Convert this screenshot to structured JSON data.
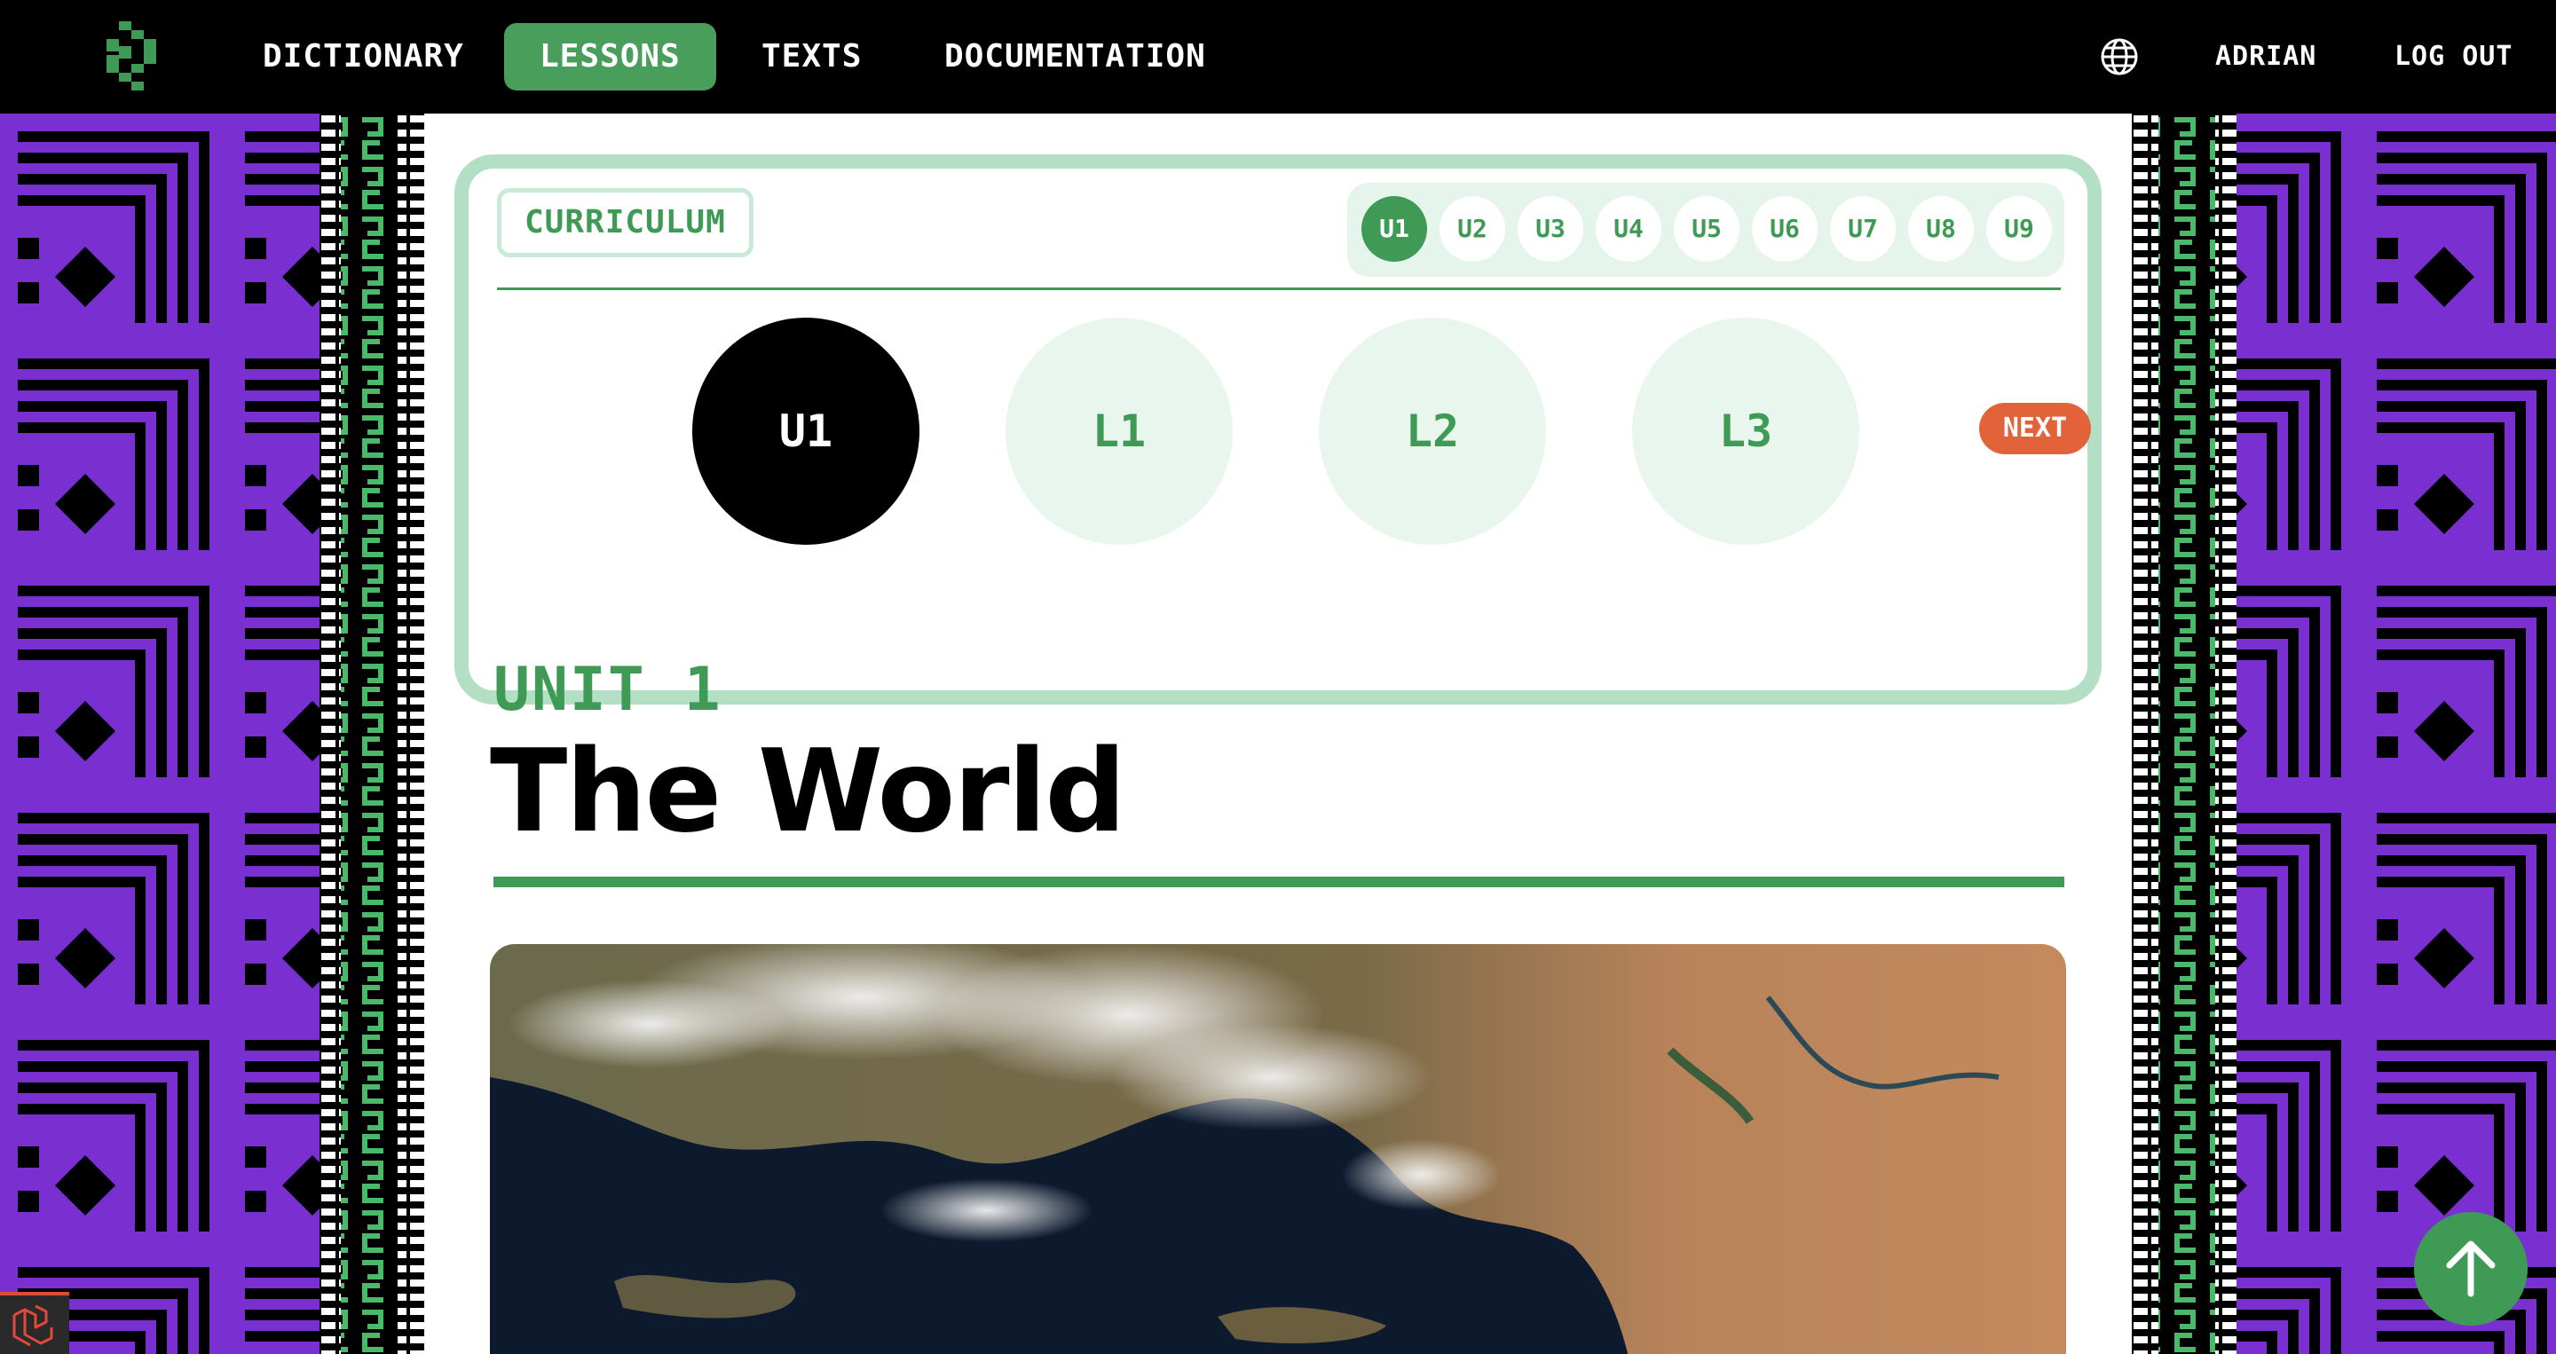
{
  "nav": {
    "links": [
      "DICTIONARY",
      "LESSONS",
      "TEXTS",
      "DOCUMENTATION"
    ],
    "active": "LESSONS",
    "user": "ADRIAN",
    "logout": "LOG OUT"
  },
  "curriculum": {
    "label": "CURRICULUM",
    "units": [
      "U1",
      "U2",
      "U3",
      "U4",
      "U5",
      "U6",
      "U7",
      "U8",
      "U9"
    ],
    "active_unit": "U1",
    "lessons": [
      "U1",
      "L1",
      "L2",
      "L3"
    ],
    "active_lesson": "U1",
    "next_label": "NEXT"
  },
  "page": {
    "kicker": "UNIT 1",
    "title": "The World"
  },
  "colors": {
    "accent_green": "#3f9a56",
    "light_green": "#b3e0c4",
    "next_orange": "#e2623a",
    "border_purple": "#7a2fd0"
  },
  "icons": [
    "logo-icon",
    "globe-icon",
    "arrow-up-icon",
    "laravel-icon"
  ]
}
